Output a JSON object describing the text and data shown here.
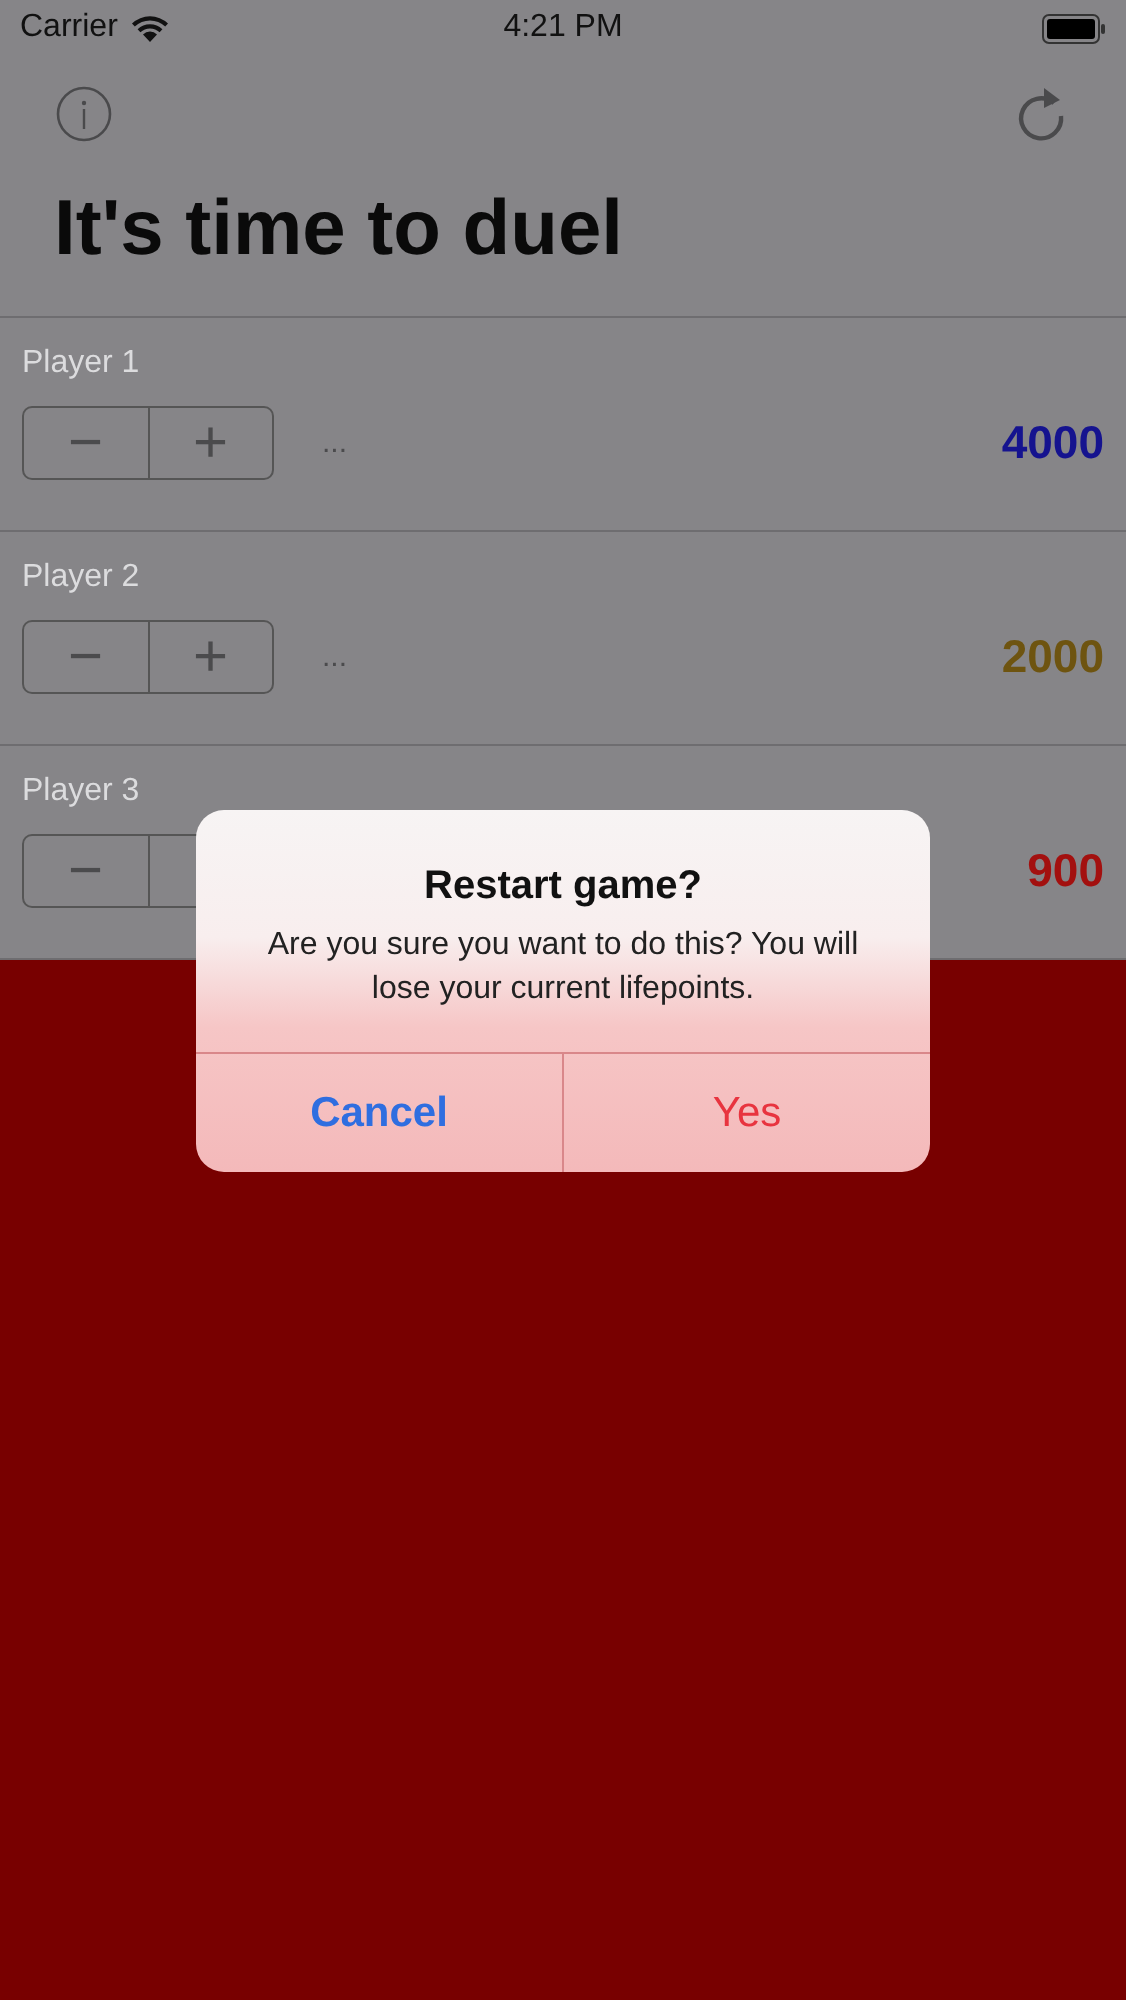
{
  "status_bar": {
    "carrier": "Carrier",
    "time": "4:21 PM"
  },
  "title": "It's time to duel",
  "players": [
    {
      "name": "Player 1",
      "minus": "−",
      "plus": "+",
      "more": "...",
      "points": "4000",
      "color": "#15138f"
    },
    {
      "name": "Player 2",
      "minus": "−",
      "plus": "+",
      "more": "...",
      "points": "2000",
      "color": "#6e5410"
    },
    {
      "name": "Player 3",
      "minus": "−",
      "points": "900",
      "color": "#a3100f"
    }
  ],
  "alert": {
    "title": "Restart game?",
    "message": "Are you sure you want to do this? You will lose your current lifepoints.",
    "buttons": [
      {
        "label": "Cancel",
        "kind": "default"
      },
      {
        "label": "Yes",
        "kind": "destructive"
      }
    ]
  }
}
